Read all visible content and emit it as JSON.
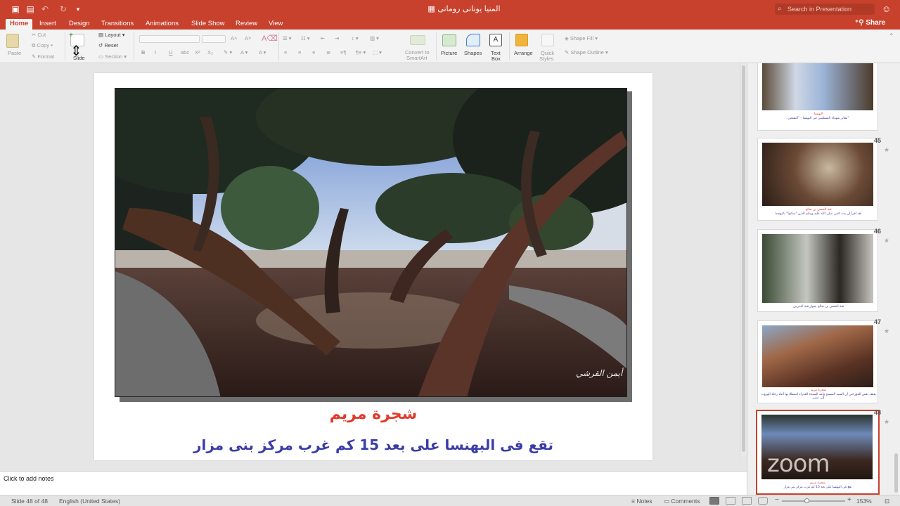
{
  "window": {
    "title": "المنيا يونانى رومانى",
    "search_placeholder": "Search in Presentation"
  },
  "tabs": [
    {
      "label": "Home",
      "active": true
    },
    {
      "label": "Insert",
      "active": false
    },
    {
      "label": "Design",
      "active": false
    },
    {
      "label": "Transitions",
      "active": false
    },
    {
      "label": "Animations",
      "active": false
    },
    {
      "label": "Slide Show",
      "active": false
    },
    {
      "label": "Review",
      "active": false
    },
    {
      "label": "View",
      "active": false
    }
  ],
  "share_label": "Share",
  "ribbon": {
    "paste": "Paste",
    "cut": "Cut",
    "copy": "Copy",
    "format": "Format",
    "new_slide": "Slide",
    "layout": "Layout",
    "reset": "Reset",
    "section": "Section",
    "convert_smartart_1": "Convert to",
    "convert_smartart_2": "SmartArt",
    "picture": "Picture",
    "shapes": "Shapes",
    "text_box_1": "Text",
    "text_box_2": "Box",
    "arrange": "Arrange",
    "quick_styles_1": "Quick",
    "quick_styles_2": "Styles",
    "shape_fill": "Shape Fill",
    "shape_outline": "Shape Outline"
  },
  "slide": {
    "title": "شجرة مريم",
    "subtitle": "تقع فى البهنسا على بعد 15 كم غرب مركز بنى مزار",
    "signature": "أيمن القرشي"
  },
  "notes_placeholder": "Click to add notes",
  "thumbnails": [
    {
      "number": "",
      "caption_red": "البهنسا",
      "caption": "مقابر شهداء المسلمين فى البهنسا - \"البقيعين\"",
      "selected": false
    },
    {
      "number": "45",
      "caption_red": "قبة الحسن بن صالح",
      "caption": "لقد أقرأ أن بيت النبى صلى الله عليه وسلم الذين \"سكنوا\" بالبهنسا",
      "selected": false
    },
    {
      "number": "46",
      "caption_red": "",
      "caption": "قبة الحسن بن صالح بجوار قبة البدريين",
      "selected": false
    },
    {
      "number": "47",
      "caption_red": "شجرة مريم",
      "caption": "يعتقد بعض المؤرخين أن السيد المسيح وأمه السيدة العذراء استظلا بها أثناء رحلة الهروب إلى مصر",
      "selected": false
    },
    {
      "number": "48",
      "caption_red": "شجرة مريم",
      "caption": "تقع فى البهنسا على بعد 15 كم غرب مركز بنى مزار",
      "selected": true
    }
  ],
  "zoom_watermark": "zoom",
  "status": {
    "slide_counter": "Slide 48 of 48",
    "language": "English (United States)",
    "notes": "Notes",
    "comments": "Comments",
    "zoom_level": "153%"
  },
  "colors": {
    "accent": "#c8412d",
    "title_red": "#e23b2b",
    "subtitle_blue": "#3b3da6"
  }
}
